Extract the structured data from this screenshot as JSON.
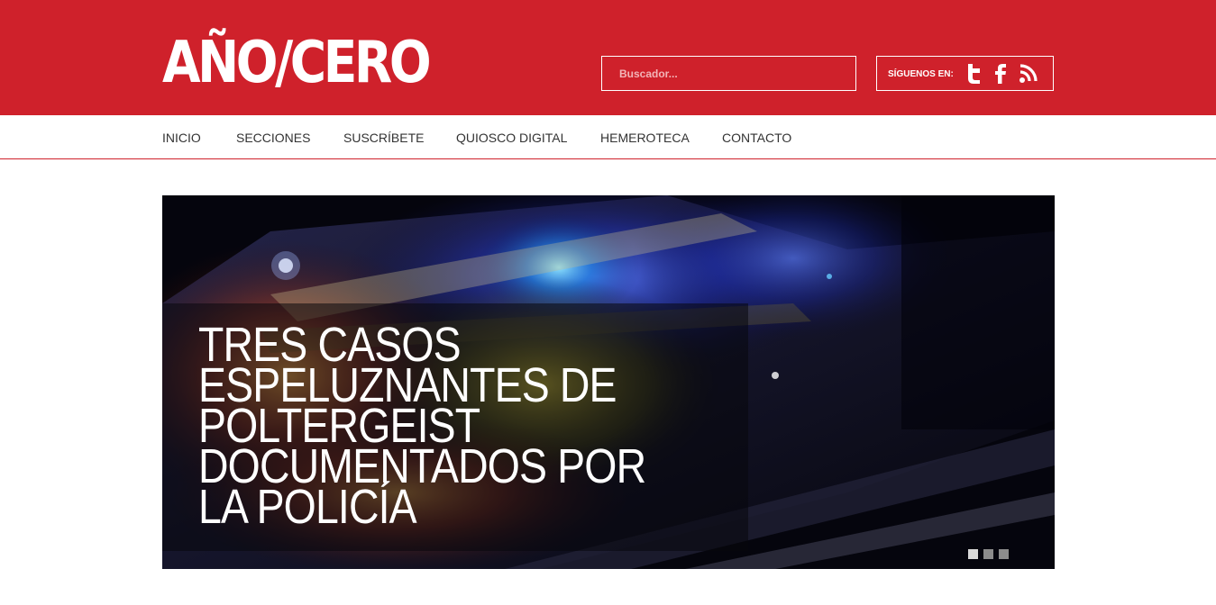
{
  "header": {
    "logo_text": "AÑO/CERO",
    "search": {
      "placeholder": "Buscador...",
      "value": ""
    },
    "social": {
      "label": "SÍGUENOS EN:",
      "icons": [
        "twitter-icon",
        "facebook-icon",
        "rss-icon"
      ]
    }
  },
  "nav": {
    "items": [
      {
        "label": "INICIO"
      },
      {
        "label": "SECCIONES"
      },
      {
        "label": "SUSCRÍBETE"
      },
      {
        "label": "QUIOSCO DIGITAL"
      },
      {
        "label": "HEMEROTECA"
      },
      {
        "label": "CONTACTO"
      }
    ]
  },
  "hero": {
    "title": "TRES CASOS ESPELUZNANTES DE POLTERGEIST DOCUMENTADOS POR LA POLICÍA",
    "slides_total": 3,
    "active_slide": 1
  },
  "colors": {
    "brand_red": "#cf212b",
    "nav_text": "#333333",
    "hero_bg": "#04040a"
  }
}
